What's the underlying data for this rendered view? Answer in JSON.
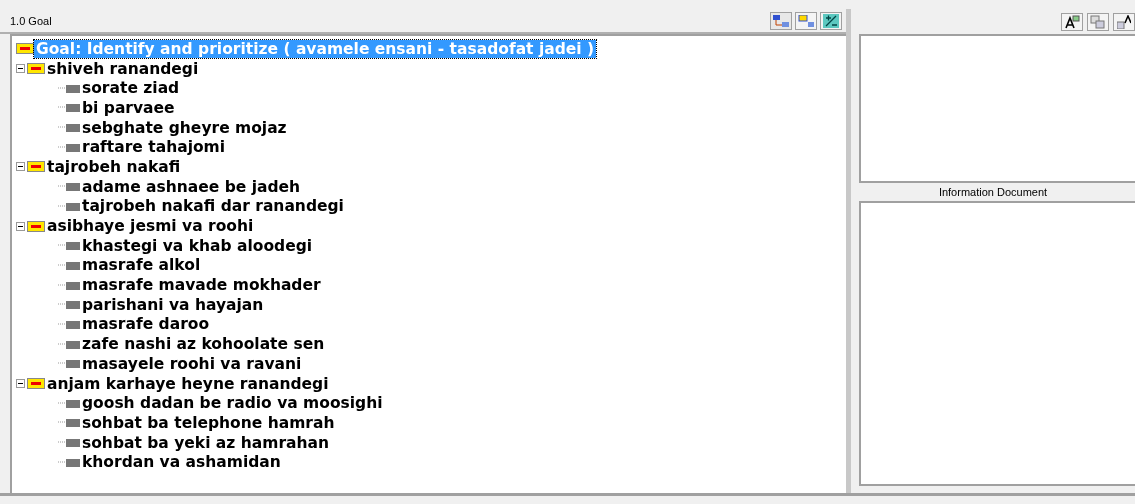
{
  "left_panel": {
    "title": "1.0 Goal"
  },
  "tree": {
    "label": "Goal: Identify and prioritize ( avamele ensani - tasadofat jadei )",
    "selected": true,
    "children": [
      {
        "label": "shiveh ranandegi",
        "selected": false,
        "expanded": true,
        "children": [
          {
            "label": "sorate ziad",
            "selected": false
          },
          {
            "label": "bi parvaee",
            "selected": false
          },
          {
            "label": "sebghate gheyre mojaz",
            "selected": false
          },
          {
            "label": "raftare tahajomi",
            "selected": false
          }
        ]
      },
      {
        "label": "tajrobeh nakafi",
        "selected": false,
        "expanded": true,
        "children": [
          {
            "label": "adame ashnaee be jadeh",
            "selected": false
          },
          {
            "label": "tajrobeh nakafi dar ranandegi",
            "selected": false
          }
        ]
      },
      {
        "label": "asibhaye jesmi va roohi",
        "selected": false,
        "expanded": true,
        "children": [
          {
            "label": "khastegi va khab aloodegi",
            "selected": false
          },
          {
            "label": "masrafe alkol",
            "selected": false
          },
          {
            "label": "masrafe mavade mokhader",
            "selected": false
          },
          {
            "label": "parishani va hayajan",
            "selected": false
          },
          {
            "label": "masrafe daroo",
            "selected": false
          },
          {
            "label": "zafe nashi az kohoolate sen",
            "selected": false
          },
          {
            "label": "masayele roohi va ravani",
            "selected": false
          }
        ]
      },
      {
        "label": "anjam karhaye heyne ranandegi",
        "selected": false,
        "expanded": true,
        "children": [
          {
            "label": "goosh dadan be radio va moosighi",
            "selected": false
          },
          {
            "label": "sohbat ba telephone hamrah",
            "selected": false
          },
          {
            "label": "sohbat ba yeki az hamrahan",
            "selected": false
          },
          {
            "label": "khordan va ashamidan",
            "selected": false
          }
        ]
      }
    ]
  },
  "right_panel": {
    "document_label": "Information Document"
  }
}
